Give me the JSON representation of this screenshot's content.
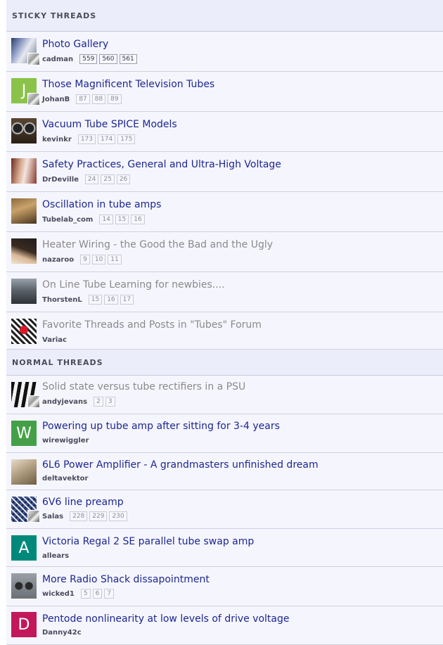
{
  "sticky_header": "STICKY THREADS",
  "normal_header": "NORMAL THREADS",
  "sticky_threads": [
    {
      "title": "Photo Gallery",
      "author": "cadman",
      "pages": [
        "559",
        "560",
        "561"
      ],
      "avatar_icon": "photo-avatar-icon"
    },
    {
      "title": "Those Magnificent Television Tubes",
      "author": "JohanB",
      "pages": [
        "87",
        "88",
        "89"
      ],
      "avatar_letter": "J",
      "avatar_color": "#8bc34a"
    },
    {
      "title": "Vacuum Tube SPICE Models",
      "author": "kevinkr",
      "pages": [
        "173",
        "174",
        "175"
      ],
      "avatar_icon": "reel-to-reel-avatar-icon"
    },
    {
      "title": "Safety Practices, General and Ultra-High Voltage",
      "author": "DrDeville",
      "pages": [
        "24",
        "25",
        "26"
      ],
      "avatar_icon": "photo-avatar-icon"
    },
    {
      "title": "Oscillation in tube amps",
      "author": "Tubelab_com",
      "pages": [
        "14",
        "15",
        "16"
      ],
      "avatar_icon": "photo-avatar-icon"
    },
    {
      "title": "Heater Wiring - the Good the Bad and the Ugly",
      "author": "nazaroo",
      "pages": [
        "9",
        "10",
        "11"
      ],
      "avatar_icon": "photo-avatar-icon"
    },
    {
      "title": "On Line Tube Learning for newbies....",
      "author": "ThorstenL",
      "pages": [
        "15",
        "16",
        "17"
      ],
      "avatar_icon": "photo-avatar-icon"
    },
    {
      "title": "Favorite Threads and Posts in \"Tubes\" Forum",
      "author": "Variac",
      "pages": [],
      "avatar_icon": "pattern-avatar-icon"
    }
  ],
  "normal_threads": [
    {
      "title": "Solid state versus tube rectifiers in a PSU",
      "author": "andyjevans",
      "pages": [
        "2",
        "3"
      ],
      "avatar_icon": "keyboard-avatar-icon"
    },
    {
      "title": "Powering up tube amp after sitting for 3-4 years",
      "author": "wirewiggler",
      "pages": [],
      "avatar_letter": "W",
      "avatar_color": "#43a047"
    },
    {
      "title": "6L6 Power Amplifier - A grandmasters unfinished dream",
      "author": "deltavektor",
      "pages": [],
      "avatar_icon": "photo-avatar-icon"
    },
    {
      "title": "6V6 line preamp",
      "author": "Salas",
      "pages": [
        "228",
        "229",
        "230"
      ],
      "avatar_icon": "circuit-avatar-icon"
    },
    {
      "title": "Victoria Regal 2 SE parallel tube swap amp",
      "author": "allears",
      "pages": [],
      "avatar_letter": "A",
      "avatar_color": "#00897b"
    },
    {
      "title": "More Radio Shack dissapointment",
      "author": "wicked1",
      "pages": [
        "5",
        "6",
        "7"
      ],
      "avatar_icon": "photo-avatar-icon"
    },
    {
      "title": "Pentode nonlinearity at low levels of drive voltage",
      "author": "Danny42c",
      "pages": [],
      "avatar_letter": "D",
      "avatar_color": "#c2185b"
    }
  ]
}
